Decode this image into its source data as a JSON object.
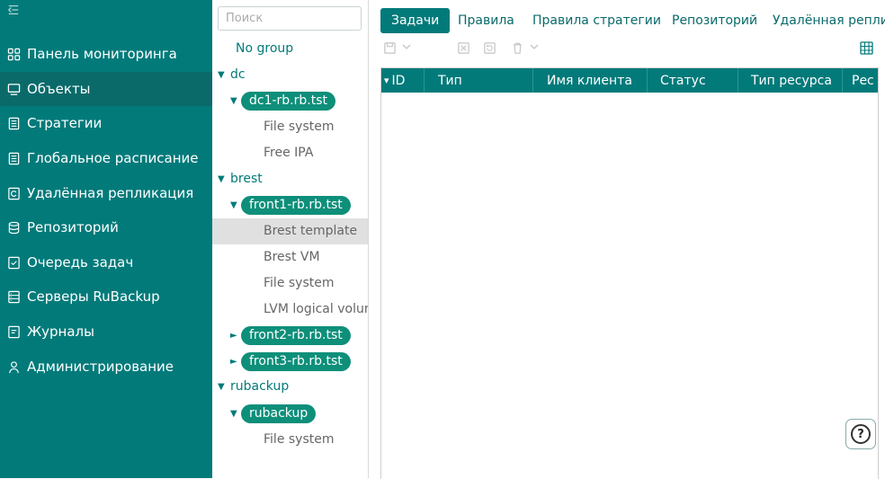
{
  "sidebar": {
    "collapse_icon": "collapse-left-icon",
    "items": [
      {
        "label": "Панель мониторинга",
        "icon": "dashboard-icon",
        "active": false
      },
      {
        "label": "Объекты",
        "icon": "monitor-icon",
        "active": true
      },
      {
        "label": "Стратегии",
        "icon": "document-icon",
        "active": false
      },
      {
        "label": "Глобальное расписание",
        "icon": "list-icon",
        "active": false
      },
      {
        "label": "Удалённая репликация",
        "icon": "replication-icon",
        "active": false
      },
      {
        "label": "Репозиторий",
        "icon": "database-icon",
        "active": false
      },
      {
        "label": "Очередь задач",
        "icon": "checklist-icon",
        "active": false
      },
      {
        "label": "Серверы RuBackup",
        "icon": "server-icon",
        "active": false
      },
      {
        "label": "Журналы",
        "icon": "log-icon",
        "active": false
      },
      {
        "label": "Администрирование",
        "icon": "user-icon",
        "active": false
      }
    ],
    "colors": {
      "background": "#037a7a",
      "active": "#0a6a6a"
    }
  },
  "tree": {
    "search_placeholder": "Поиск",
    "nodes": [
      {
        "label": "No group",
        "kind": "group"
      },
      {
        "label": "dc",
        "kind": "group",
        "expanded": true
      },
      {
        "label": "dc1-rb.rb.tst",
        "kind": "client",
        "expanded": true
      },
      {
        "label": "File system",
        "kind": "resource"
      },
      {
        "label": "Free IPA",
        "kind": "resource"
      },
      {
        "label": "brest",
        "kind": "group",
        "expanded": true
      },
      {
        "label": "front1-rb.rb.tst",
        "kind": "client",
        "expanded": true
      },
      {
        "label": "Brest template",
        "kind": "resource",
        "selected": true
      },
      {
        "label": "Brest VM",
        "kind": "resource"
      },
      {
        "label": "File system",
        "kind": "resource"
      },
      {
        "label": "LVM logical volum",
        "kind": "resource"
      },
      {
        "label": "front2-rb.rb.tst",
        "kind": "client",
        "expanded": false
      },
      {
        "label": "front3-rb.rb.tst",
        "kind": "client",
        "expanded": false
      },
      {
        "label": "rubackup",
        "kind": "group",
        "expanded": true
      },
      {
        "label": "rubackup",
        "kind": "client",
        "expanded": true
      },
      {
        "label": "File system",
        "kind": "resource"
      }
    ]
  },
  "main": {
    "tabs": [
      {
        "label": "Задачи",
        "active": true
      },
      {
        "label": "Правила",
        "active": false
      },
      {
        "label": "Правила стратегии",
        "active": false
      },
      {
        "label": "Репозиторий",
        "active": false
      },
      {
        "label": "Удалённая реплик",
        "active": false
      }
    ],
    "toolbar": {
      "icons": [
        "save-icon",
        "dropdown-icon",
        "cancel-icon",
        "restore-icon",
        "delete-icon",
        "dropdown-icon",
        "table-settings-icon"
      ]
    },
    "table": {
      "sort_indicator": "▾",
      "columns": [
        "ID",
        "Тип",
        "Имя клиента",
        "Статус",
        "Тип ресурса",
        "Рес"
      ],
      "rows": []
    },
    "help_label": "?"
  }
}
